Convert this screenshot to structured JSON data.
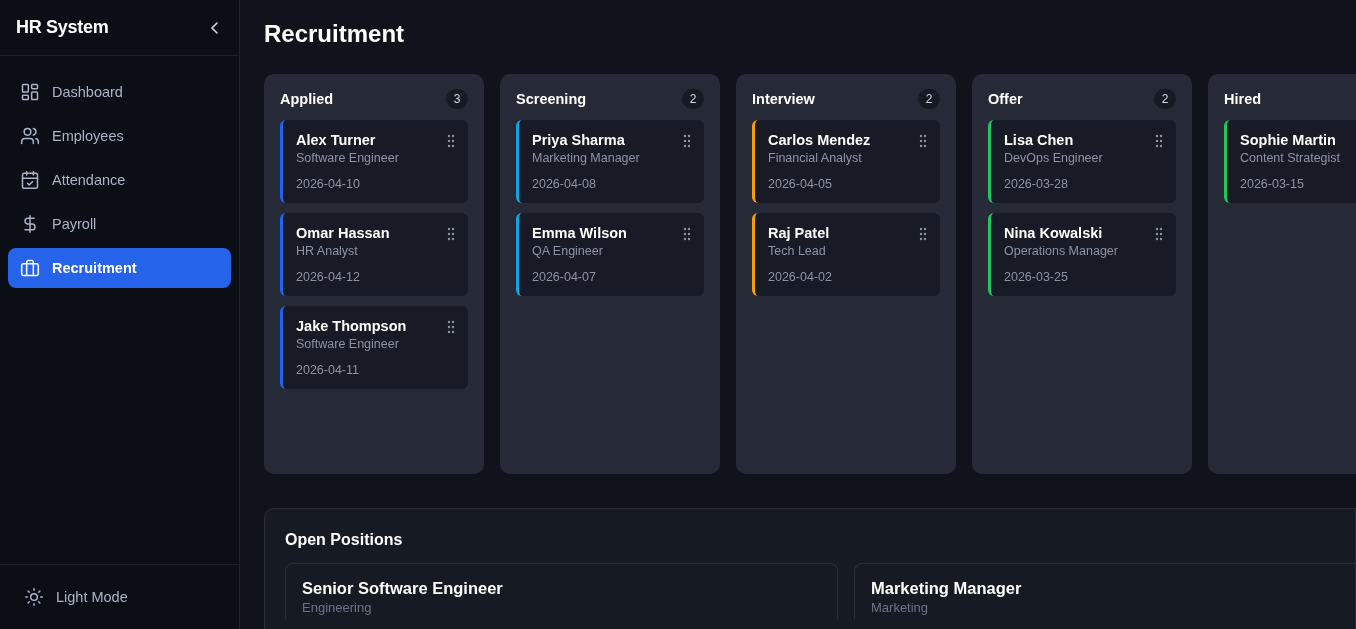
{
  "sidebar": {
    "title": "HR System",
    "items": [
      {
        "label": "Dashboard",
        "selected": false
      },
      {
        "label": "Employees",
        "selected": false
      },
      {
        "label": "Attendance",
        "selected": false
      },
      {
        "label": "Payroll",
        "selected": false
      },
      {
        "label": "Recruitment",
        "selected": true
      }
    ],
    "footer": {
      "label": "Light Mode"
    }
  },
  "page_title": "Recruitment",
  "board": {
    "columns": [
      {
        "title": "Applied",
        "count": "3",
        "color": "#2563eb",
        "cards": [
          {
            "name": "Alex Turner",
            "role": "Software Engineer",
            "date": "2026-04-10"
          },
          {
            "name": "Omar Hassan",
            "role": "HR Analyst",
            "date": "2026-04-12"
          },
          {
            "name": "Jake Thompson",
            "role": "Software Engineer",
            "date": "2026-04-11"
          }
        ]
      },
      {
        "title": "Screening",
        "count": "2",
        "color": "#0ea5e9",
        "cards": [
          {
            "name": "Priya Sharma",
            "role": "Marketing Manager",
            "date": "2026-04-08"
          },
          {
            "name": "Emma Wilson",
            "role": "QA Engineer",
            "date": "2026-04-07"
          }
        ]
      },
      {
        "title": "Interview",
        "count": "2",
        "color": "#f59e0b",
        "cards": [
          {
            "name": "Carlos Mendez",
            "role": "Financial Analyst",
            "date": "2026-04-05"
          },
          {
            "name": "Raj Patel",
            "role": "Tech Lead",
            "date": "2026-04-02"
          }
        ]
      },
      {
        "title": "Offer",
        "count": "2",
        "color": "#22c55e",
        "cards": [
          {
            "name": "Lisa Chen",
            "role": "DevOps Engineer",
            "date": "2026-03-28"
          },
          {
            "name": "Nina Kowalski",
            "role": "Operations Manager",
            "date": "2026-03-25"
          }
        ]
      },
      {
        "title": "Hired",
        "color": "#22c55e",
        "cards": [
          {
            "name": "Sophie Martin",
            "role": "Content Strategist",
            "date": "2026-03-15"
          }
        ]
      }
    ]
  },
  "open_positions": {
    "title": "Open Positions",
    "positions": [
      {
        "title": "Senior Software Engineer",
        "department": "Engineering"
      },
      {
        "title": "Marketing Manager",
        "department": "Marketing"
      }
    ]
  }
}
